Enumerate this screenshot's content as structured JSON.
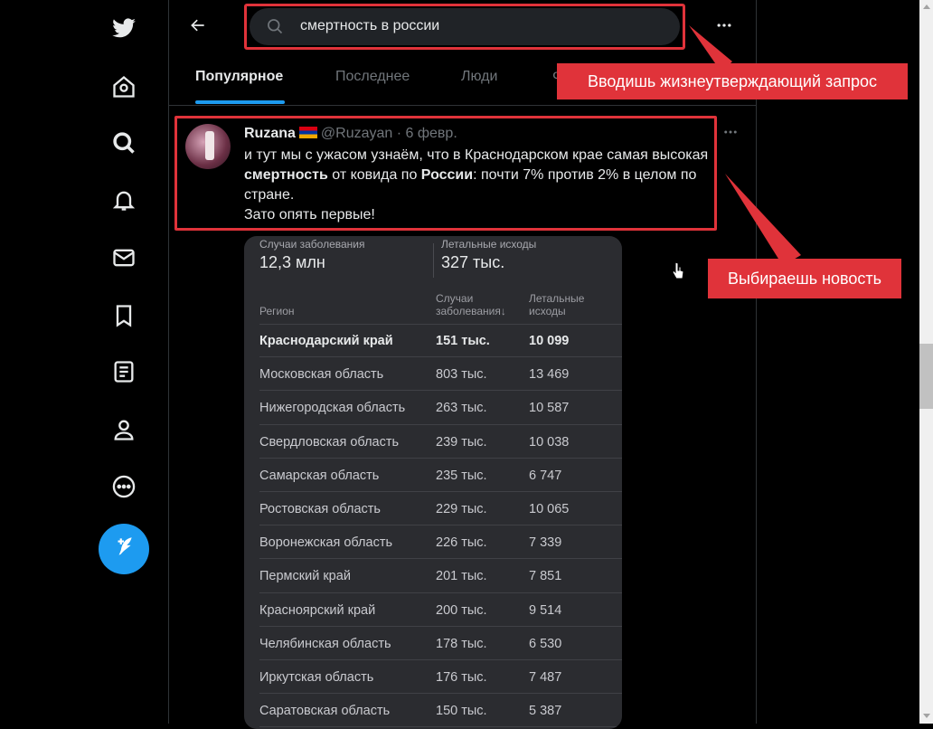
{
  "sidebar": {
    "icons": [
      "twitter-logo-icon",
      "home-icon",
      "explore-icon",
      "notifications-icon",
      "messages-icon",
      "bookmarks-icon",
      "lists-icon",
      "profile-icon",
      "more-icon"
    ],
    "tweet_button_label": "+"
  },
  "header": {
    "search_value": "смертность в россии",
    "back_icon": "back-arrow-icon",
    "more_icon": "more-icon"
  },
  "tabs": [
    {
      "label": "Популярное",
      "active": true
    },
    {
      "label": "Последнее",
      "active": false
    },
    {
      "label": "Люди",
      "active": false
    },
    {
      "label": "Ф",
      "active": false
    }
  ],
  "tweet": {
    "name": "Ruzana",
    "handle": "@Ruzayan",
    "date": "· 6 февр.",
    "text_part1": "и тут мы с ужасом узнаём, что в Краснодарском крае самая высокая ",
    "text_bold1": "смертность",
    "text_part2": " от ковида по ",
    "text_bold2": "России",
    "text_part3": ": почти 7% против 2% в целом по стране.",
    "text_line2": "Зато опять первые!"
  },
  "table": {
    "stat1_label": "Случаи заболевания",
    "stat1_value": "12,3 млн",
    "stat2_label": "Летальные исходы",
    "stat2_value": "327 тыс.",
    "col_region": "Регион",
    "col_cases_line1": "Случаи",
    "col_cases_line2": "заболевания↓",
    "col_deaths_line1": "Летальные",
    "col_deaths_line2": "исходы",
    "rows": [
      {
        "region": "Краснодарский край",
        "cases": "151 тыс.",
        "deaths": "10 099"
      },
      {
        "region": "Московская область",
        "cases": "803 тыс.",
        "deaths": "13 469"
      },
      {
        "region": "Нижегородская область",
        "cases": "263 тыс.",
        "deaths": "10 587"
      },
      {
        "region": "Свердловская область",
        "cases": "239 тыс.",
        "deaths": "10 038"
      },
      {
        "region": "Самарская область",
        "cases": "235 тыс.",
        "deaths": "6 747"
      },
      {
        "region": "Ростовская область",
        "cases": "229 тыс.",
        "deaths": "10 065"
      },
      {
        "region": "Воронежская область",
        "cases": "226 тыс.",
        "deaths": "7 339"
      },
      {
        "region": "Пермский край",
        "cases": "201 тыс.",
        "deaths": "7 851"
      },
      {
        "region": "Красноярский край",
        "cases": "200 тыс.",
        "deaths": "9 514"
      },
      {
        "region": "Челябинская область",
        "cases": "178 тыс.",
        "deaths": "6 530"
      },
      {
        "region": "Иркутская область",
        "cases": "176 тыс.",
        "deaths": "7 487"
      },
      {
        "region": "Саратовская область",
        "cases": "150 тыс.",
        "deaths": "5 387"
      }
    ]
  },
  "annotations": {
    "callout_search": "Вводишь жизнеутверждающий запрос",
    "callout_news": "Выбираешь новость",
    "color": "#e0333a"
  }
}
